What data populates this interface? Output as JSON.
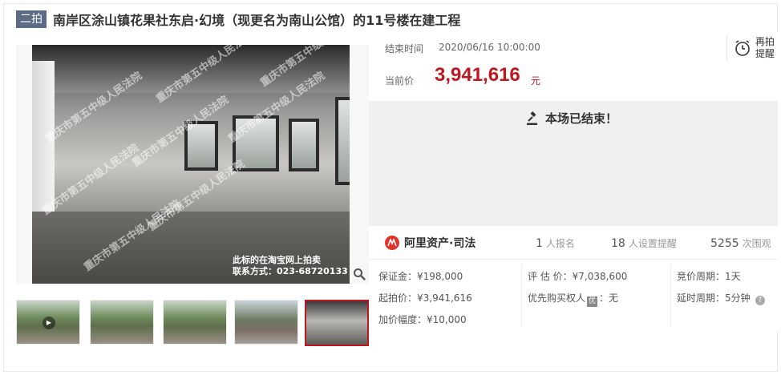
{
  "header": {
    "badge": "二拍",
    "title": "南岸区涂山镇花果社东启·幻境（现更名为南山公馆）的11号楼在建工程"
  },
  "image": {
    "watermarks": [
      "重庆市第五中级人民法院",
      "重庆市第五中级人民法院",
      "重庆市第五中级人民法院",
      "重庆市第五中级人民法院",
      "重庆市第五中级人民法院",
      "重庆市第五中级人民法院",
      "重庆市第五中级人民法院",
      "重庆市第五中级人民法院"
    ],
    "caption_line1": "此标的在淘宝网上拍卖",
    "caption_line2": "联系方式：023-68720133"
  },
  "thumbnails": [
    {
      "type": "video",
      "active": false
    },
    {
      "type": "road",
      "active": false
    },
    {
      "type": "road",
      "active": false
    },
    {
      "type": "house",
      "active": false
    },
    {
      "type": "room",
      "active": true
    }
  ],
  "auction": {
    "end_label": "结束时间",
    "end_time": "2020/06/16 10:00:00",
    "current_label": "当前价",
    "current_price": "3,941,616",
    "currency_unit": "元",
    "remind_line1": "再拍",
    "remind_line2": "提醒",
    "status": "本场已结束！"
  },
  "stats": {
    "brand": "阿里资产·司法",
    "signups_count": "1",
    "signups_label": "人报名",
    "reminders_count": "18",
    "reminders_label": "人设置提醒",
    "views_count": "5255",
    "views_label": "次围观"
  },
  "details": {
    "deposit": "保证金：¥198,000",
    "start_price": "起拍价：¥3,941,616",
    "increment": "加价幅度：¥10,000",
    "appraisal": "评 估 价：¥7,038,600",
    "priority_label": "优先购买权人",
    "priority_icon": "优",
    "priority_value": "：无",
    "cycle": "竞价周期：1天",
    "delay": "延时周期：5分钟"
  },
  "colors": {
    "price_red": "#c0161f",
    "badge_bg": "#5b6b85",
    "status_bg": "#f0f0f0",
    "brand_red": "#e2332a"
  }
}
